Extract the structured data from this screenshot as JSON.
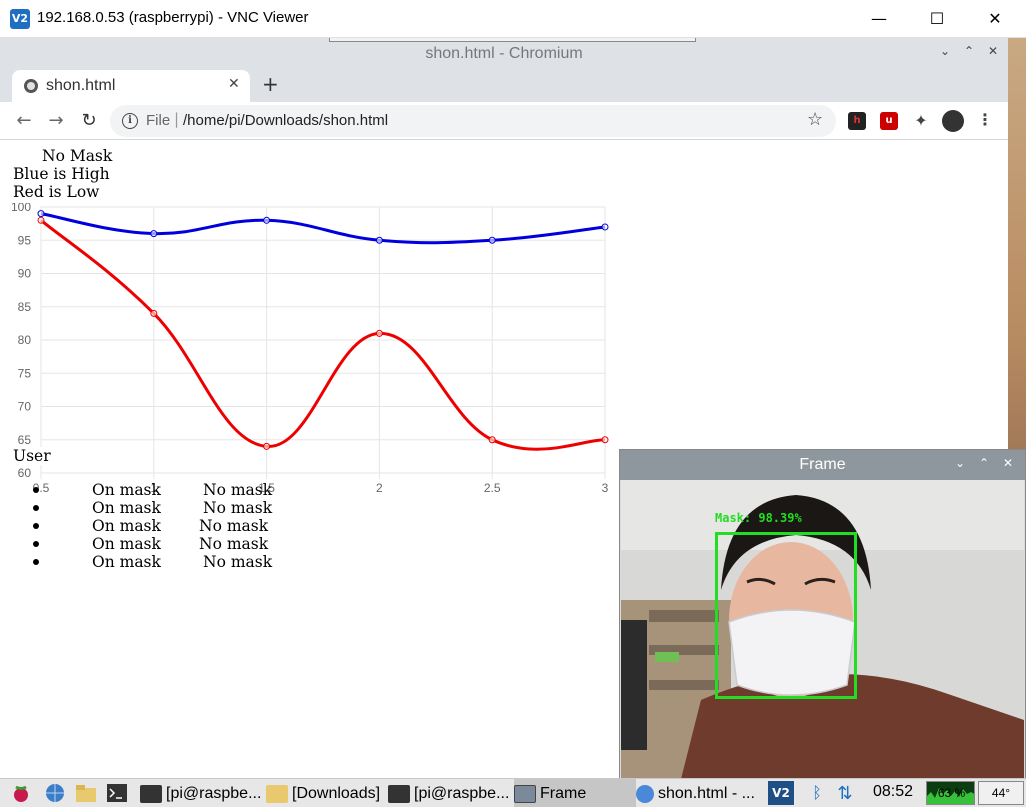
{
  "vnc": {
    "title": "192.168.0.53 (raspberrypi) - VNC Viewer",
    "logo": "V2",
    "controls": [
      "minimize-icon",
      "maximize-icon",
      "close-icon"
    ]
  },
  "browser": {
    "window_title": "shon.html - Chromium",
    "tab_title": "shon.html",
    "scheme_label": "File",
    "url": "/home/pi/Downloads/shon.html",
    "icons": [
      "back-arrow-icon",
      "forward-arrow-icon",
      "reload-icon",
      "info-icon",
      "star-icon",
      "hypothesis-extension-icon",
      "ublock-extension-icon",
      "extensions-puzzle-icon",
      "profile-icon",
      "menu-dots-icon"
    ]
  },
  "page": {
    "heading": "No Mask",
    "legend_blue": "Blue is High",
    "legend_red": "Red is Low",
    "user_label": "User",
    "rows": [
      {
        "a": "On mask",
        "b": "No mask"
      },
      {
        "a": "On mask",
        "b": "No mask"
      },
      {
        "a": "On mask",
        "b": "No mask"
      },
      {
        "a": "On mask",
        "b": "No mask"
      },
      {
        "a": "On mask",
        "b": "No mask"
      }
    ]
  },
  "chart_data": {
    "type": "line",
    "x": [
      0.5,
      1,
      1.5,
      2,
      2.5,
      3
    ],
    "x_ticks": [
      "0.5",
      "1",
      "1.5",
      "2",
      "2.5",
      "3"
    ],
    "y_ticks": [
      "60",
      "65",
      "70",
      "75",
      "80",
      "85",
      "90",
      "95",
      "100"
    ],
    "xlim": [
      0.5,
      3
    ],
    "ylim": [
      60,
      100
    ],
    "grid": true,
    "series": [
      {
        "color": "#0000dd",
        "values": [
          99,
          96,
          98,
          95,
          95,
          97
        ]
      },
      {
        "color": "#ee0000",
        "values": [
          98,
          84,
          64,
          81,
          65,
          65
        ]
      }
    ]
  },
  "frame_window": {
    "title": "Frame",
    "detection_label": "Mask: 98.39%",
    "box_color": "#22dd22"
  },
  "taskbar": {
    "items": [
      {
        "label": "[pi@raspbe...",
        "icon": "terminal-icon"
      },
      {
        "label": "[Downloads]",
        "icon": "folder-icon"
      },
      {
        "label": "[pi@raspbe...",
        "icon": "terminal-icon"
      },
      {
        "label": "Frame",
        "icon": "window-icon"
      },
      {
        "label": "shon.html - ...",
        "icon": "chromium-icon"
      }
    ],
    "clock": "08:52",
    "cpu": "63 %",
    "temp": "44°"
  }
}
